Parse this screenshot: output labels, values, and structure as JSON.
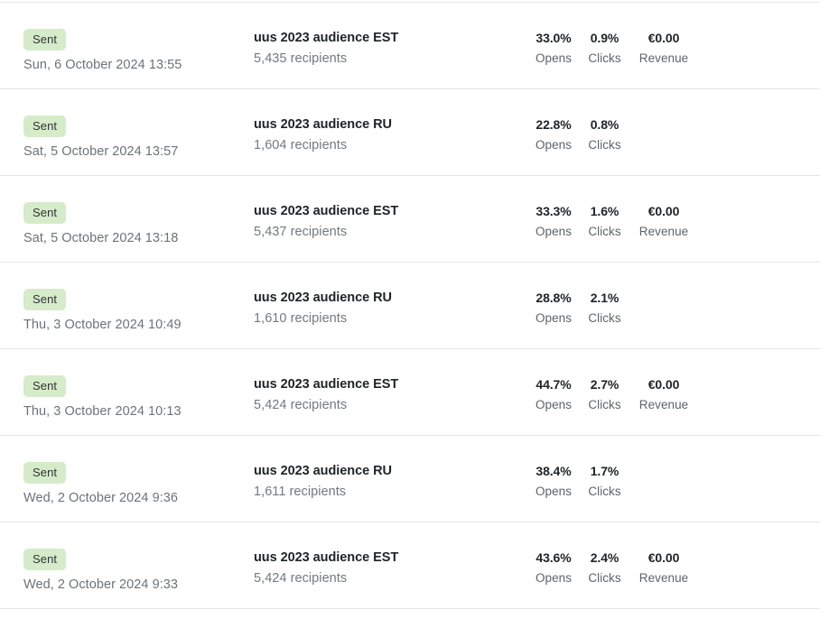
{
  "list": {
    "stat_labels": {
      "opens": "Opens",
      "clicks": "Clicks",
      "revenue": "Revenue"
    },
    "colors": {
      "badge_background": "#d6ebc9",
      "badge_text": "#2f3437",
      "divider": "#e3e5e8",
      "primary_text": "#1f2326",
      "muted_text": "#6c7378",
      "page_background": "#ffffff"
    },
    "rows": [
      {
        "status": "Sent",
        "date": "Sun, 6 October 2024 13:55",
        "campaign": "uus 2023 audience EST",
        "recipients": "5,435 recipients",
        "opens": "33.0%",
        "clicks": "0.9%",
        "revenue": "€0.00",
        "has_revenue": true
      },
      {
        "status": "Sent",
        "date": "Sat, 5 October 2024 13:57",
        "campaign": "uus 2023 audience RU",
        "recipients": "1,604 recipients",
        "opens": "22.8%",
        "clicks": "0.8%",
        "revenue": "",
        "has_revenue": false
      },
      {
        "status": "Sent",
        "date": "Sat, 5 October 2024 13:18",
        "campaign": "uus 2023 audience EST",
        "recipients": "5,437 recipients",
        "opens": "33.3%",
        "clicks": "1.6%",
        "revenue": "€0.00",
        "has_revenue": true
      },
      {
        "status": "Sent",
        "date": "Thu, 3 October 2024 10:49",
        "campaign": "uus 2023 audience RU",
        "recipients": "1,610 recipients",
        "opens": "28.8%",
        "clicks": "2.1%",
        "revenue": "",
        "has_revenue": false
      },
      {
        "status": "Sent",
        "date": "Thu, 3 October 2024 10:13",
        "campaign": "uus 2023 audience EST",
        "recipients": "5,424 recipients",
        "opens": "44.7%",
        "clicks": "2.7%",
        "revenue": "€0.00",
        "has_revenue": true
      },
      {
        "status": "Sent",
        "date": "Wed, 2 October 2024 9:36",
        "campaign": "uus 2023 audience RU",
        "recipients": "1,611 recipients",
        "opens": "38.4%",
        "clicks": "1.7%",
        "revenue": "",
        "has_revenue": false
      },
      {
        "status": "Sent",
        "date": "Wed, 2 October 2024 9:33",
        "campaign": "uus 2023 audience EST",
        "recipients": "5,424 recipients",
        "opens": "43.6%",
        "clicks": "2.4%",
        "revenue": "€0.00",
        "has_revenue": true
      }
    ]
  }
}
